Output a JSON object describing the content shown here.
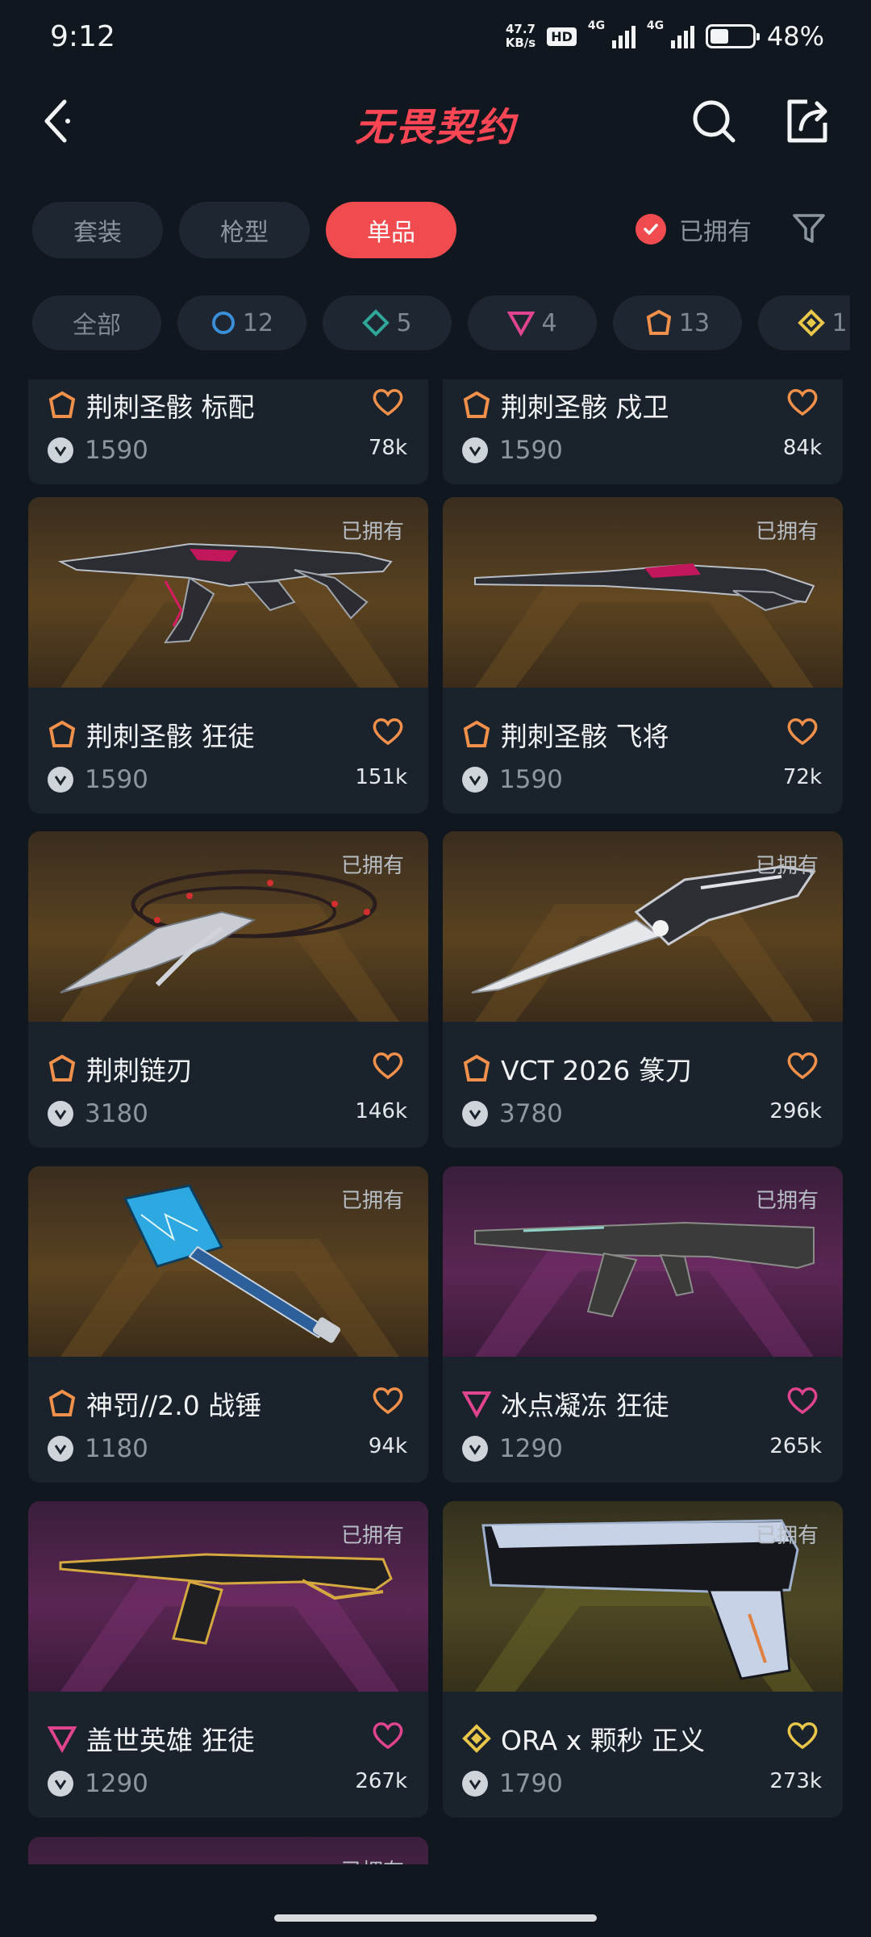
{
  "status_bar": {
    "time": "9:12",
    "net_speed_top": "47.7",
    "net_speed_bottom": "KB/s",
    "hd": "HD",
    "sig1": "4G",
    "sig2": "4G",
    "battery": "48%",
    "battery_level": 0.48
  },
  "header": {
    "title": "无畏契约",
    "brand_color": "#ff4655"
  },
  "tabs": [
    {
      "label": "套装",
      "active": false
    },
    {
      "label": "枪型",
      "active": false
    },
    {
      "label": "单品",
      "active": true
    }
  ],
  "owned_filter": {
    "label": "已拥有",
    "checked": true
  },
  "tiers": [
    {
      "label": "全部",
      "icon": "",
      "count": ""
    },
    {
      "label": "",
      "icon": "select-tier-icon",
      "count": "12"
    },
    {
      "label": "",
      "icon": "deluxe-tier-icon",
      "count": "5"
    },
    {
      "label": "",
      "icon": "premium-tier-icon",
      "count": "4"
    },
    {
      "label": "",
      "icon": "exclusive-tier-icon",
      "count": "13"
    },
    {
      "label": "",
      "icon": "ultra-tier-icon",
      "count": "1"
    }
  ],
  "items": [
    {
      "name": "荆刺圣骸 标配",
      "price": "1590",
      "likes": "78k",
      "owned": "",
      "tier": "exclusive"
    },
    {
      "name": "荆刺圣骸 戍卫",
      "price": "1590",
      "likes": "84k",
      "owned": "",
      "tier": "exclusive"
    },
    {
      "name": "荆刺圣骸 狂徒",
      "price": "1590",
      "likes": "151k",
      "owned": "已拥有",
      "tier": "exclusive"
    },
    {
      "name": "荆刺圣骸 飞将",
      "price": "1590",
      "likes": "72k",
      "owned": "已拥有",
      "tier": "exclusive"
    },
    {
      "name": "荆刺链刃",
      "price": "3180",
      "likes": "146k",
      "owned": "已拥有",
      "tier": "exclusive"
    },
    {
      "name": "VCT 2026 篆刀",
      "price": "3780",
      "likes": "296k",
      "owned": "已拥有",
      "tier": "exclusive"
    },
    {
      "name": "神罚//2.0 战锤",
      "price": "1180",
      "likes": "94k",
      "owned": "已拥有",
      "tier": "exclusive"
    },
    {
      "name": "冰点凝冻 狂徒",
      "price": "1290",
      "likes": "265k",
      "owned": "已拥有",
      "tier": "premium"
    },
    {
      "name": "盖世英雄 狂徒",
      "price": "1290",
      "likes": "267k",
      "owned": "已拥有",
      "tier": "premium"
    },
    {
      "name": "ORA x 颗秒 正义",
      "price": "1790",
      "likes": "273k",
      "owned": "已拥有",
      "tier": "ultra"
    },
    {
      "name": "",
      "price": "",
      "likes": "",
      "owned": "已拥有",
      "tier": "premium"
    }
  ],
  "colors": {
    "exclusive": "#f0904a",
    "premium": "#e0448f",
    "ultra": "#e8c64a",
    "deluxe": "#2fa79a",
    "select": "#3a8fd6"
  }
}
